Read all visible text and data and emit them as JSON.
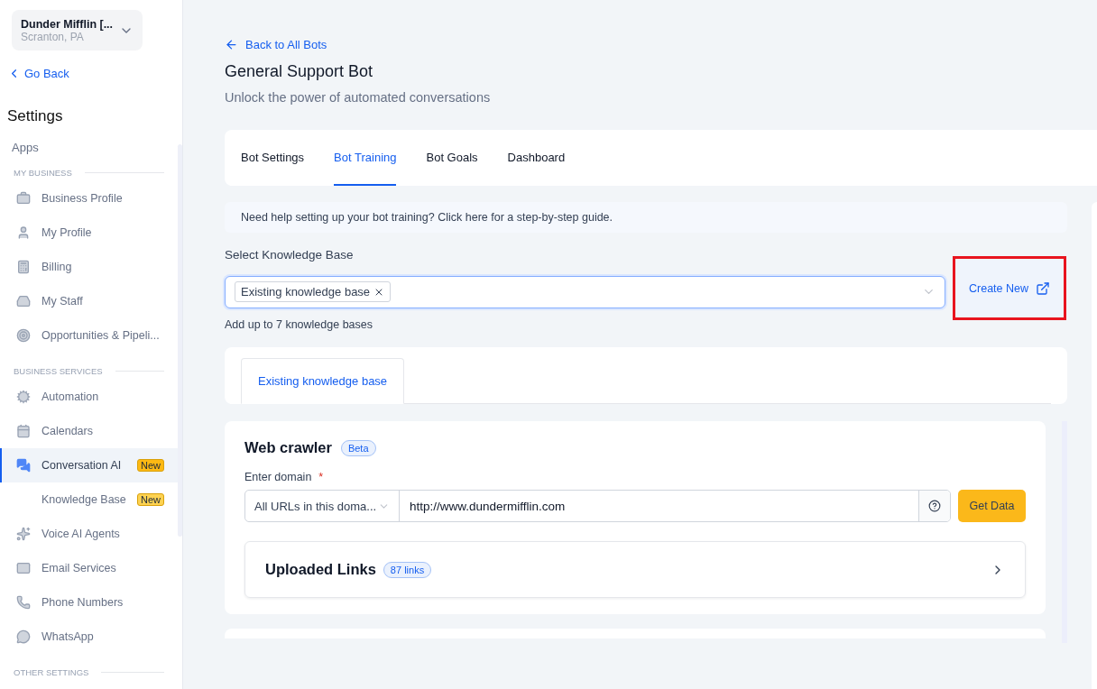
{
  "workspace": {
    "name": "Dunder Mifflin [...",
    "location": "Scranton, PA"
  },
  "back_link": "Go Back",
  "sidebar": {
    "title": "Settings",
    "top_items": [
      {
        "label": "Apps"
      }
    ],
    "sections": [
      {
        "heading": "MY BUSINESS",
        "items": [
          {
            "label": "Business Profile",
            "selected": false
          },
          {
            "label": "My Profile",
            "selected": false
          },
          {
            "label": "Billing",
            "selected": false
          },
          {
            "label": "My Staff",
            "selected": false
          },
          {
            "label": "Opportunities & Pipeli...",
            "selected": false
          }
        ]
      },
      {
        "heading": "BUSINESS SERVICES",
        "items": [
          {
            "label": "Automation",
            "selected": false
          },
          {
            "label": "Calendars",
            "selected": false
          },
          {
            "label": "Conversation AI",
            "selected": true,
            "badge": "New",
            "children": [
              {
                "label": "Knowledge Base",
                "selected": false,
                "badge": "New"
              }
            ]
          },
          {
            "label": "Voice AI Agents",
            "selected": false
          },
          {
            "label": "Email Services",
            "selected": false
          },
          {
            "label": "Phone Numbers",
            "selected": false
          },
          {
            "label": "WhatsApp",
            "selected": false
          }
        ]
      },
      {
        "heading": "OTHER SETTINGS"
      }
    ]
  },
  "breadcrumb": "Back to All Bots",
  "title": "General Support Bot",
  "subtitle": "Unlock the power of automated conversations",
  "tabs": [
    {
      "label": "Bot Settings",
      "selected": false
    },
    {
      "label": "Bot Training",
      "selected": true
    },
    {
      "label": "Bot Goals",
      "selected": false
    },
    {
      "label": "Dashboard",
      "selected": false
    }
  ],
  "help_banner": "Need help setting up your bot training? Click here for a step-by-step guide.",
  "knowledge_select": {
    "label": "Select Knowledge Base",
    "chips": [
      "Existing knowledge base"
    ],
    "hint": "Add up to 7 knowledge bases"
  },
  "create_button": {
    "label": "Create New",
    "highlighted": true
  },
  "kb_tabs": [
    {
      "label": "Existing knowledge base",
      "selected": true
    }
  ],
  "web_crawler": {
    "title": "Web crawler",
    "badge": "Beta",
    "field_label": "Enter domain",
    "required_mark": "*",
    "scope": "All URLs in this doma...",
    "url": "http://www.dundermifflin.com",
    "button": "Get Data"
  },
  "uploaded_links": {
    "title": "Uploaded Links",
    "count": "87 links"
  }
}
